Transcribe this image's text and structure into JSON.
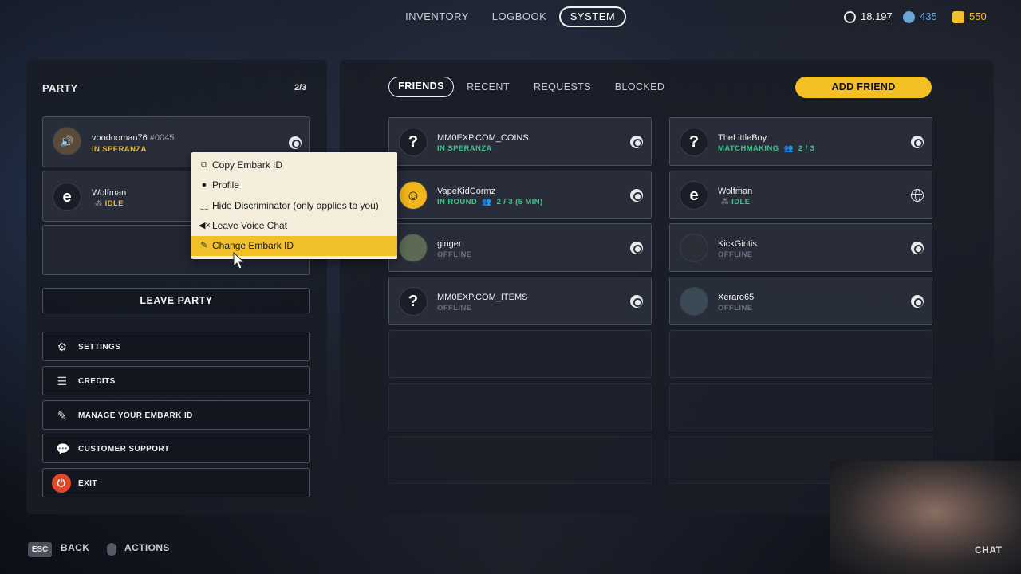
{
  "nav": {
    "tabs": [
      "INVENTORY",
      "LOGBOOK",
      "SYSTEM"
    ],
    "active_tab": "SYSTEM",
    "currencies": [
      {
        "icon": "vault-token-icon",
        "value": "18.197",
        "color": "#e9e9ec"
      },
      {
        "icon": "bond-icon",
        "value": "435",
        "color": "#6aa6d6"
      },
      {
        "icon": "multibucks-icon",
        "value": "550",
        "color": "#f2c02d"
      }
    ]
  },
  "party": {
    "title": "PARTY",
    "count": "2/3",
    "members": [
      {
        "name": "voodooman76",
        "discriminator": "#0045",
        "status": "IN SPERANZA",
        "status_color": "yellow"
      },
      {
        "name": "Wolfman",
        "discriminator": "",
        "status": "IDLE",
        "status_color": "yellow"
      }
    ],
    "leave_label": "LEAVE PARTY"
  },
  "menu": [
    {
      "label": "SETTINGS",
      "icon": "gear-icon"
    },
    {
      "label": "CREDITS",
      "icon": "list-icon"
    },
    {
      "label": "MANAGE YOUR EMBARK ID",
      "icon": "edit-id-icon"
    },
    {
      "label": "CUSTOMER SUPPORT",
      "icon": "chat-bubbles-icon"
    },
    {
      "label": "EXIT",
      "icon": "power-icon",
      "color": "#e2472a"
    }
  ],
  "context_menu": {
    "items": [
      "Copy Embark ID",
      "Profile",
      "Hide Discriminator (only applies to you)",
      "Leave Voice Chat",
      "Change Embark ID"
    ],
    "highlighted": "Change Embark ID"
  },
  "friends": {
    "tabs": [
      "FRIENDS",
      "RECENT",
      "REQUESTS",
      "BLOCKED"
    ],
    "active_tab": "FRIENDS",
    "add_label": "ADD FRIEND",
    "list": [
      {
        "name": "MM0EXP.COM_COINS",
        "status": "IN SPERANZA",
        "platform": "steam-icon"
      },
      {
        "name": "TheLittleBoy",
        "status": "MATCHMAKING",
        "extra": "2 / 3",
        "platform": "steam-icon"
      },
      {
        "name": "VapeKidCormz",
        "status": "IN ROUND",
        "extra": "2 / 3 (5 MIN)",
        "platform": "steam-icon"
      },
      {
        "name": "Wolfman",
        "status": "IDLE",
        "platform": "globe-icon"
      },
      {
        "name": "ginger",
        "status": "OFFLINE",
        "platform": "steam-icon"
      },
      {
        "name": "KickGiritis",
        "status": "OFFLINE",
        "platform": "steam-icon"
      },
      {
        "name": "MM0EXP.COM_ITEMS",
        "status": "OFFLINE",
        "platform": "steam-icon"
      },
      {
        "name": "Xeraro65",
        "status": "OFFLINE",
        "platform": "steam-icon"
      }
    ]
  },
  "bottom": {
    "esc_key": "ESC",
    "back_label": "BACK",
    "actions_label": "ACTIONS",
    "chat_label": "CHAT"
  }
}
